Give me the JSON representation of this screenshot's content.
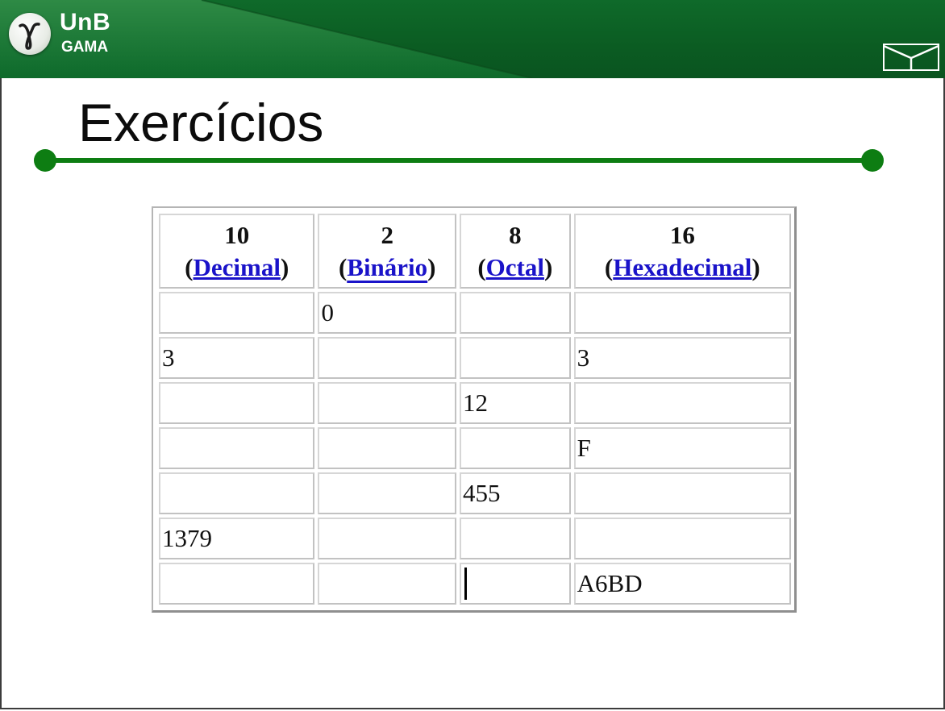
{
  "header": {
    "logo_top": "UnB",
    "logo_bottom": "GAMA",
    "colors": {
      "banner": "#0b5c22",
      "accent": "#0d7d12",
      "link": "#1a13c9"
    }
  },
  "slide": {
    "title": "Exercícios"
  },
  "table": {
    "headers": [
      {
        "base": "10",
        "name": "Decimal"
      },
      {
        "base": "2",
        "name": "Binário"
      },
      {
        "base": "8",
        "name": "Octal"
      },
      {
        "base": "16",
        "name": "Hexadecimal"
      }
    ],
    "rows": [
      [
        "",
        "0",
        "",
        ""
      ],
      [
        "3",
        "",
        "",
        "3"
      ],
      [
        "",
        "",
        "12",
        ""
      ],
      [
        "",
        "",
        "",
        "F"
      ],
      [
        "",
        "",
        "455",
        ""
      ],
      [
        "1379",
        "",
        "",
        ""
      ],
      [
        "",
        "",
        "",
        "A6BD"
      ]
    ]
  }
}
